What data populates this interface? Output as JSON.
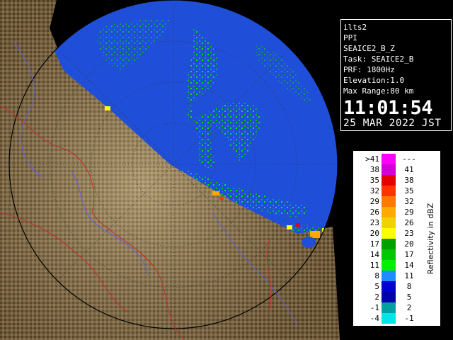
{
  "radar": {
    "site": "ilts2",
    "mode": "PPI",
    "product": "SEAICE2_B_Z",
    "task_line": "Task: SEAICE2_B",
    "prf_line": "PRF: 1800Hz",
    "elevation_line": "Elevation:1.0",
    "range_line": "Max Range:80 km",
    "time": "11:01:54",
    "date": "25 MAR 2022 JST"
  },
  "legend": {
    "title": "Reflectivity in dBZ",
    "rows": [
      {
        "left": ">41",
        "right": "---",
        "color": "#ff00ff"
      },
      {
        "left": "38",
        "right": "41",
        "color": "#d200d2"
      },
      {
        "left": "35",
        "right": "38",
        "color": "#e60000"
      },
      {
        "left": "32",
        "right": "35",
        "color": "#ff3200"
      },
      {
        "left": "29",
        "right": "32",
        "color": "#ff7800"
      },
      {
        "left": "26",
        "right": "29",
        "color": "#ffaa00"
      },
      {
        "left": "23",
        "right": "26",
        "color": "#f0d200"
      },
      {
        "left": "20",
        "right": "23",
        "color": "#ffff00"
      },
      {
        "left": "17",
        "right": "20",
        "color": "#00a000"
      },
      {
        "left": "14",
        "right": "17",
        "color": "#00c800"
      },
      {
        "left": "11",
        "right": "14",
        "color": "#00f000"
      },
      {
        "left": "8",
        "right": "11",
        "color": "#1e8cff"
      },
      {
        "left": "5",
        "right": "8",
        "color": "#0000d2"
      },
      {
        "left": "2",
        "right": "5",
        "color": "#0000aa"
      },
      {
        "left": "-1",
        "right": "2",
        "color": "#00a0a0"
      },
      {
        "left": "-4",
        "right": "-1",
        "color": "#00e6e6"
      }
    ]
  },
  "colors": {
    "sea": "#1f4fd8",
    "land_light": "#b8a479",
    "land_dark": "#4a3a20",
    "outer": "#000000"
  }
}
